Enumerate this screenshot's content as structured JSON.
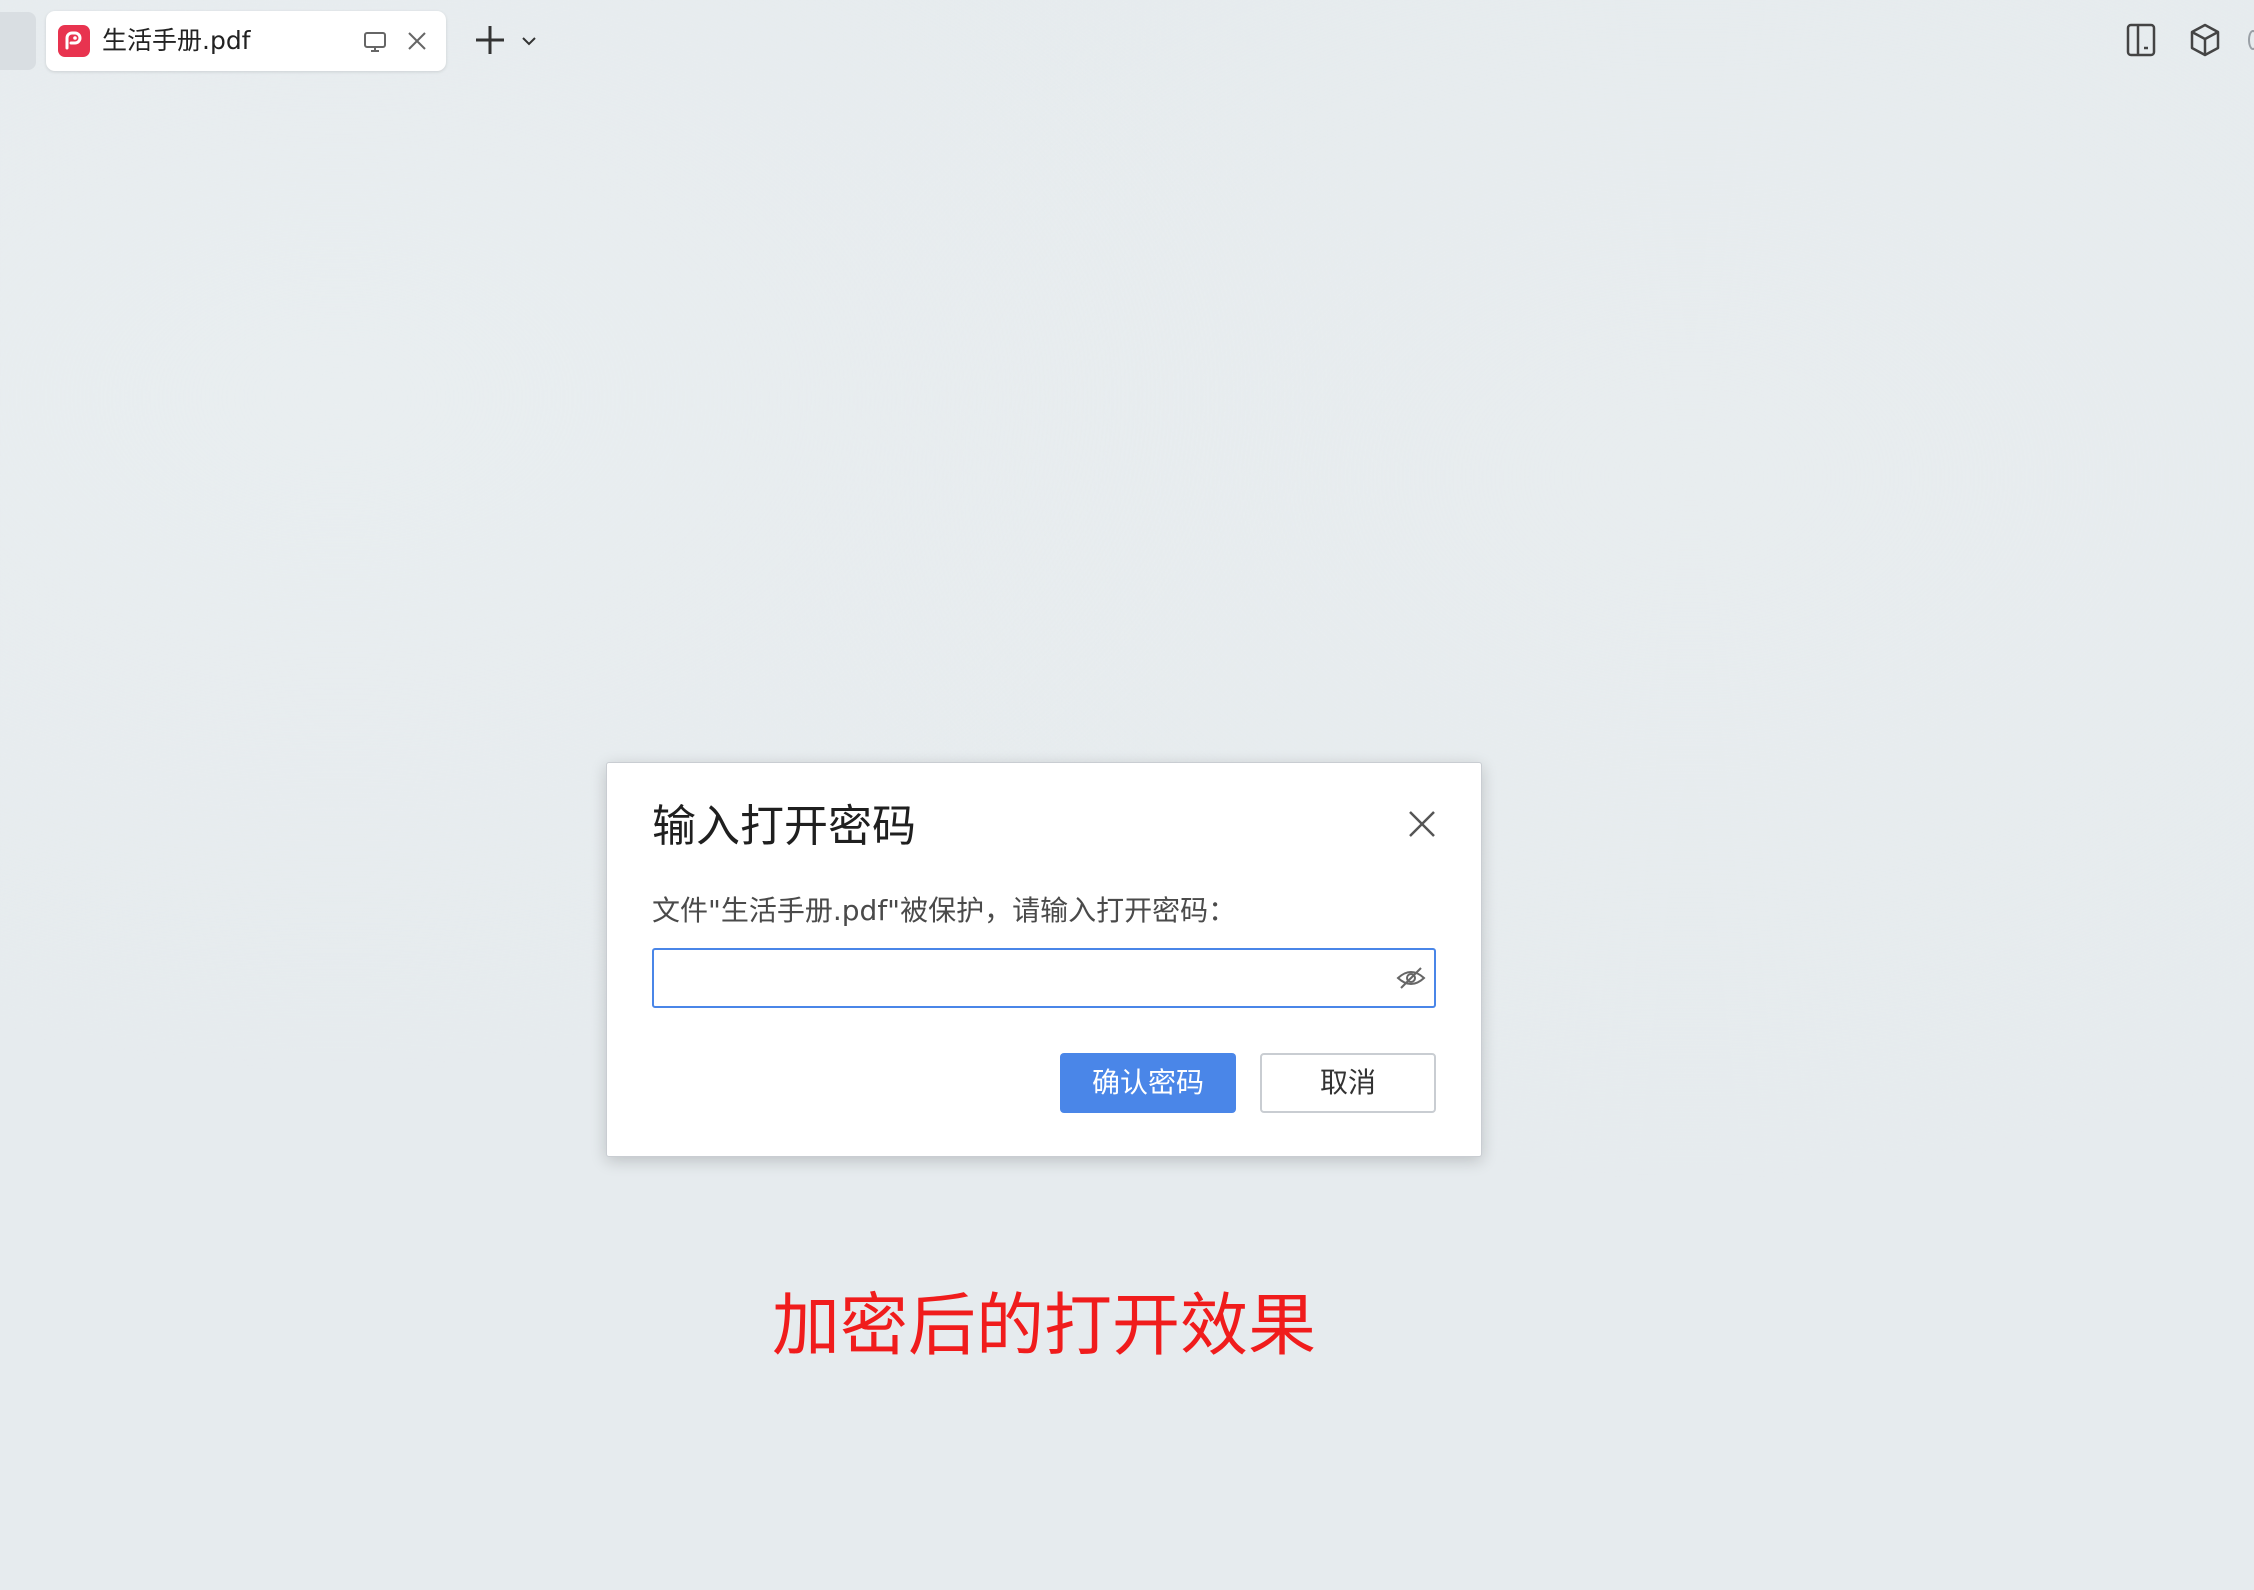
{
  "tab": {
    "title": "生活手册.pdf"
  },
  "dialog": {
    "title": "输入打开密码",
    "message": "文件\"生活手册.pdf\"被保护，请输入打开密码：",
    "password_value": "",
    "confirm_label": "确认密码",
    "cancel_label": "取消"
  },
  "caption": "加密后的打开效果",
  "colors": {
    "accent": "#4a86e8",
    "app_icon": "#e8334f",
    "caption": "#f01c1c",
    "background": "#e6ebee"
  },
  "icons": {
    "app": "pdf-app-icon",
    "screen": "monitor-icon",
    "tab_close": "close-icon",
    "new_tab": "plus-icon",
    "new_tab_menu": "chevron-down-icon",
    "top_right_1": "tablet-icon",
    "top_right_2": "cube-icon",
    "password_visibility": "eye-off-icon",
    "dialog_close": "close-icon"
  }
}
